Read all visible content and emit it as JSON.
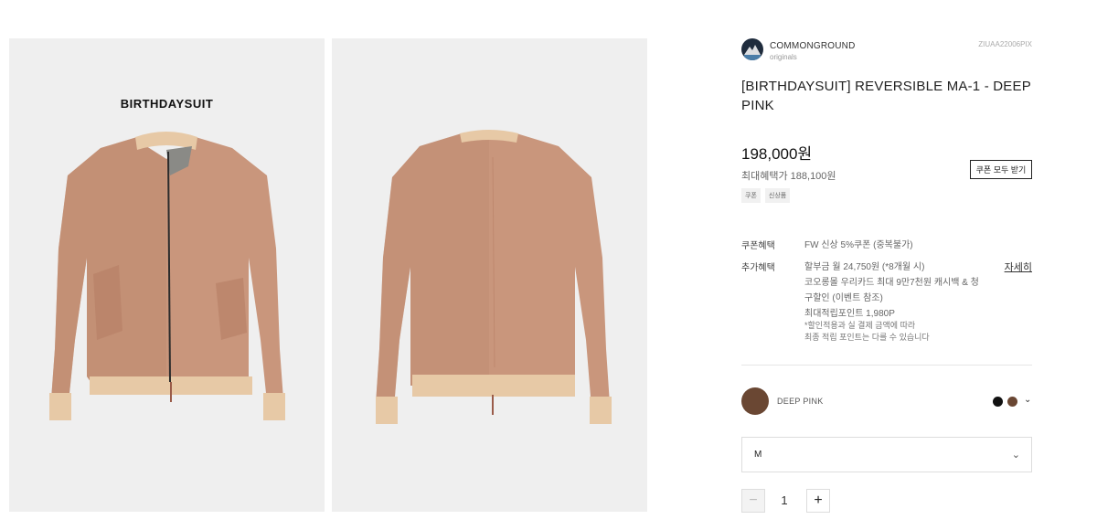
{
  "gallery": {
    "front_brand_print": "BIRTHDAYSUIT",
    "background_color": "#efefef",
    "jacket_color": "#c9967c"
  },
  "brand": {
    "name": "COMMONGROUND",
    "sub": "originals",
    "product_code": "ZIUAA22006PIX"
  },
  "product": {
    "title": "[BIRTHDAYSUIT] REVERSIBLE MA-1 - DEEP PINK",
    "price": "198,000원",
    "max_benefit": "최대혜택가 188,100원",
    "coupon_button": "쿠폰 모두 받기",
    "tags": [
      "쿠폰",
      "신상품"
    ]
  },
  "benefits": {
    "coupon_label": "쿠폰혜택",
    "coupon_value": "FW 신상 5%쿠폰 (중복불가)",
    "extra_label": "추가혜택",
    "extra_lines": [
      "할부금 월 24,750원 (*8개월 시)",
      "코오롱몰 우리카드 최대 9만7천원 캐시백 & 청",
      "구할인 (이벤트 참조)",
      "최대적립포인트 1,980P"
    ],
    "detail_link": "자세히",
    "note_lines": [
      "*할인적용과 실 결제 금액에 따라",
      "최종 적립 포인트는 다를 수 있습니다"
    ]
  },
  "options": {
    "color_name": "DEEP PINK",
    "colors": [
      "#111111",
      "#6a4733"
    ],
    "size_value": "M",
    "quantity": "1",
    "minus": "−",
    "plus": "+"
  }
}
